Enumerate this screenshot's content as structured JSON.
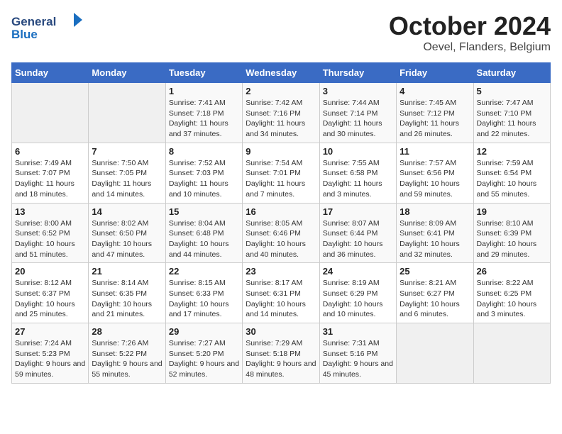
{
  "header": {
    "logo_line1": "General",
    "logo_line2": "Blue",
    "title": "October 2024",
    "subtitle": "Oevel, Flanders, Belgium"
  },
  "days_of_week": [
    "Sunday",
    "Monday",
    "Tuesday",
    "Wednesday",
    "Thursday",
    "Friday",
    "Saturday"
  ],
  "weeks": [
    [
      {
        "day": "",
        "info": ""
      },
      {
        "day": "",
        "info": ""
      },
      {
        "day": "1",
        "info": "Sunrise: 7:41 AM\nSunset: 7:18 PM\nDaylight: 11 hours and 37 minutes."
      },
      {
        "day": "2",
        "info": "Sunrise: 7:42 AM\nSunset: 7:16 PM\nDaylight: 11 hours and 34 minutes."
      },
      {
        "day": "3",
        "info": "Sunrise: 7:44 AM\nSunset: 7:14 PM\nDaylight: 11 hours and 30 minutes."
      },
      {
        "day": "4",
        "info": "Sunrise: 7:45 AM\nSunset: 7:12 PM\nDaylight: 11 hours and 26 minutes."
      },
      {
        "day": "5",
        "info": "Sunrise: 7:47 AM\nSunset: 7:10 PM\nDaylight: 11 hours and 22 minutes."
      }
    ],
    [
      {
        "day": "6",
        "info": "Sunrise: 7:49 AM\nSunset: 7:07 PM\nDaylight: 11 hours and 18 minutes."
      },
      {
        "day": "7",
        "info": "Sunrise: 7:50 AM\nSunset: 7:05 PM\nDaylight: 11 hours and 14 minutes."
      },
      {
        "day": "8",
        "info": "Sunrise: 7:52 AM\nSunset: 7:03 PM\nDaylight: 11 hours and 10 minutes."
      },
      {
        "day": "9",
        "info": "Sunrise: 7:54 AM\nSunset: 7:01 PM\nDaylight: 11 hours and 7 minutes."
      },
      {
        "day": "10",
        "info": "Sunrise: 7:55 AM\nSunset: 6:58 PM\nDaylight: 11 hours and 3 minutes."
      },
      {
        "day": "11",
        "info": "Sunrise: 7:57 AM\nSunset: 6:56 PM\nDaylight: 10 hours and 59 minutes."
      },
      {
        "day": "12",
        "info": "Sunrise: 7:59 AM\nSunset: 6:54 PM\nDaylight: 10 hours and 55 minutes."
      }
    ],
    [
      {
        "day": "13",
        "info": "Sunrise: 8:00 AM\nSunset: 6:52 PM\nDaylight: 10 hours and 51 minutes."
      },
      {
        "day": "14",
        "info": "Sunrise: 8:02 AM\nSunset: 6:50 PM\nDaylight: 10 hours and 47 minutes."
      },
      {
        "day": "15",
        "info": "Sunrise: 8:04 AM\nSunset: 6:48 PM\nDaylight: 10 hours and 44 minutes."
      },
      {
        "day": "16",
        "info": "Sunrise: 8:05 AM\nSunset: 6:46 PM\nDaylight: 10 hours and 40 minutes."
      },
      {
        "day": "17",
        "info": "Sunrise: 8:07 AM\nSunset: 6:44 PM\nDaylight: 10 hours and 36 minutes."
      },
      {
        "day": "18",
        "info": "Sunrise: 8:09 AM\nSunset: 6:41 PM\nDaylight: 10 hours and 32 minutes."
      },
      {
        "day": "19",
        "info": "Sunrise: 8:10 AM\nSunset: 6:39 PM\nDaylight: 10 hours and 29 minutes."
      }
    ],
    [
      {
        "day": "20",
        "info": "Sunrise: 8:12 AM\nSunset: 6:37 PM\nDaylight: 10 hours and 25 minutes."
      },
      {
        "day": "21",
        "info": "Sunrise: 8:14 AM\nSunset: 6:35 PM\nDaylight: 10 hours and 21 minutes."
      },
      {
        "day": "22",
        "info": "Sunrise: 8:15 AM\nSunset: 6:33 PM\nDaylight: 10 hours and 17 minutes."
      },
      {
        "day": "23",
        "info": "Sunrise: 8:17 AM\nSunset: 6:31 PM\nDaylight: 10 hours and 14 minutes."
      },
      {
        "day": "24",
        "info": "Sunrise: 8:19 AM\nSunset: 6:29 PM\nDaylight: 10 hours and 10 minutes."
      },
      {
        "day": "25",
        "info": "Sunrise: 8:21 AM\nSunset: 6:27 PM\nDaylight: 10 hours and 6 minutes."
      },
      {
        "day": "26",
        "info": "Sunrise: 8:22 AM\nSunset: 6:25 PM\nDaylight: 10 hours and 3 minutes."
      }
    ],
    [
      {
        "day": "27",
        "info": "Sunrise: 7:24 AM\nSunset: 5:23 PM\nDaylight: 9 hours and 59 minutes."
      },
      {
        "day": "28",
        "info": "Sunrise: 7:26 AM\nSunset: 5:22 PM\nDaylight: 9 hours and 55 minutes."
      },
      {
        "day": "29",
        "info": "Sunrise: 7:27 AM\nSunset: 5:20 PM\nDaylight: 9 hours and 52 minutes."
      },
      {
        "day": "30",
        "info": "Sunrise: 7:29 AM\nSunset: 5:18 PM\nDaylight: 9 hours and 48 minutes."
      },
      {
        "day": "31",
        "info": "Sunrise: 7:31 AM\nSunset: 5:16 PM\nDaylight: 9 hours and 45 minutes."
      },
      {
        "day": "",
        "info": ""
      },
      {
        "day": "",
        "info": ""
      }
    ]
  ]
}
